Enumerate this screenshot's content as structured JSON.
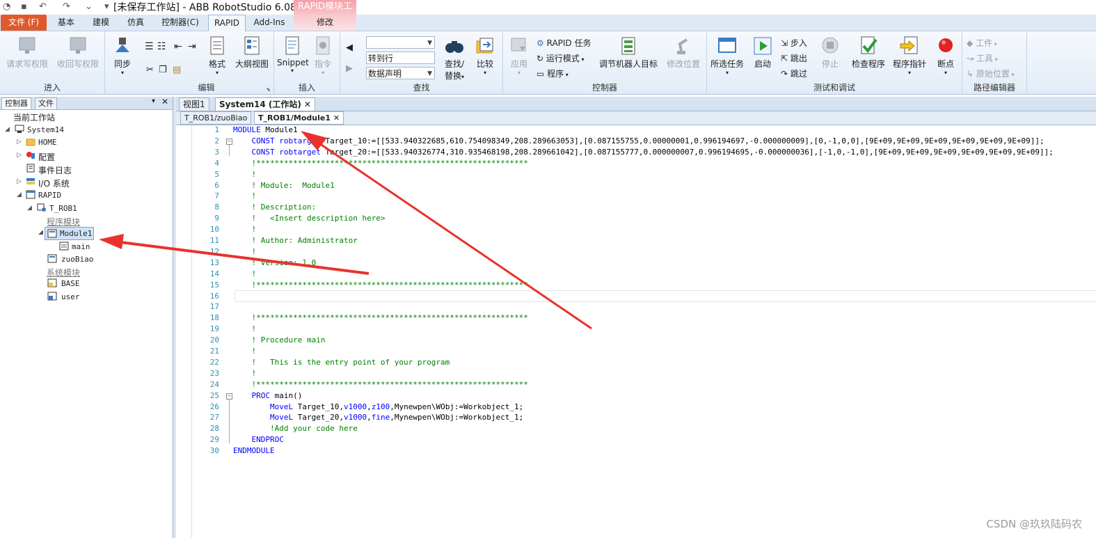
{
  "titlebar": {
    "title": "[未保存工作站] - ABB RobotStudio 6.08",
    "context_tab": "RAPID模块工具"
  },
  "ribbon_tabs": [
    "文件 (F)",
    "基本",
    "建模",
    "仿真",
    "控制器(C)",
    "RAPID",
    "Add-Ins",
    "修改"
  ],
  "ribbon": {
    "groups": {
      "access": "进入",
      "edit": "编辑",
      "insert": "插入",
      "find": "查找",
      "controller": "控制器",
      "test": "测试和调试",
      "path": "路径编辑器"
    },
    "buttons": {
      "request_write": "请求写权限",
      "revoke_write": "收回写权限",
      "sync": "同步",
      "format": "格式",
      "outline": "大纲视图",
      "snippet": "Snippet",
      "instruction": "指令",
      "find_replace_1": "查找/",
      "find_replace_2": "替换",
      "compare": "比较",
      "apply": "应用",
      "rapid_task": "RAPID 任务",
      "run_mode": "运行模式",
      "program": "程序",
      "adjust_targets": "调节机器人目标",
      "modify_position": "修改位置",
      "selected_tasks": "所选任务",
      "start": "启动",
      "step_in": "步入",
      "step_out": "跳出",
      "step_over": "跳过",
      "stop": "停止",
      "check_program": "检查程序",
      "program_pointer": "程序指针",
      "breakpoint": "断点",
      "workobject": "工件",
      "tool": "工具",
      "home_position": "原始位置"
    },
    "find_combo_1": "",
    "find_combo_2": "转到行",
    "find_combo_3": "数据声明"
  },
  "left_panel": {
    "tabs": [
      "控制器",
      "文件"
    ],
    "tree": {
      "current_station": "当前工作站",
      "system": "System14",
      "home": "HOME",
      "config": "配置",
      "event_log": "事件日志",
      "io": "I/O 系统",
      "rapid": "RAPID",
      "task": "T_ROB1",
      "program_modules": "程序模块",
      "module1": "Module1",
      "main": "main",
      "zuobiao": "zuoBiao",
      "system_modules": "系统模块",
      "base": "BASE",
      "user": "user"
    }
  },
  "doc_tabs_top": [
    "视图1",
    "System14 (工作站)"
  ],
  "doc_tabs_second": [
    "T_ROB1/zuoBiao",
    "T_ROB1/Module1"
  ],
  "code_lines": [
    {
      "n": "1",
      "t": "MODULE Module1"
    },
    {
      "n": "2",
      "t": "    CONST robtarget Target_10:=[[533.940322685,610.754098349,208.289663053],[0.087155755,0.00000001,0.996194697,-0.000000009],[0,-1,0,0],[9E+09,9E+09,9E+09,9E+09,9E+09,9E+09]];"
    },
    {
      "n": "3",
      "t": "    CONST robtarget Target_20:=[[533.940326774,310.935468198,208.289661042],[0.087155777,0.000000007,0.996194695,-0.000000036],[-1,0,-1,0],[9E+09,9E+09,9E+09,9E+09,9E+09,9E+09]];"
    },
    {
      "n": "4",
      "t": "    !***********************************************************"
    },
    {
      "n": "5",
      "t": "    !"
    },
    {
      "n": "6",
      "t": "    ! Module:  Module1"
    },
    {
      "n": "7",
      "t": "    !"
    },
    {
      "n": "8",
      "t": "    ! Description:"
    },
    {
      "n": "9",
      "t": "    !   <Insert description here>"
    },
    {
      "n": "10",
      "t": "    !"
    },
    {
      "n": "11",
      "t": "    ! Author: Administrator"
    },
    {
      "n": "12",
      "t": "    !"
    },
    {
      "n": "13",
      "t": "    ! Version: 1.0"
    },
    {
      "n": "14",
      "t": "    !"
    },
    {
      "n": "15",
      "t": "    !***********************************************************"
    },
    {
      "n": "16",
      "t": ""
    },
    {
      "n": "17",
      "t": ""
    },
    {
      "n": "18",
      "t": "    !***********************************************************"
    },
    {
      "n": "19",
      "t": "    !"
    },
    {
      "n": "20",
      "t": "    ! Procedure main"
    },
    {
      "n": "21",
      "t": "    !"
    },
    {
      "n": "22",
      "t": "    !   This is the entry point of your program"
    },
    {
      "n": "23",
      "t": "    !"
    },
    {
      "n": "24",
      "t": "    !***********************************************************"
    },
    {
      "n": "25",
      "t": "    PROC main()"
    },
    {
      "n": "26",
      "t": "        MoveL Target_10,v1000,z100,Mynewpen\\WObj:=Workobject_1;"
    },
    {
      "n": "27",
      "t": "        MoveL Target_20,v1000,fine,Mynewpen\\WObj:=Workobject_1;"
    },
    {
      "n": "28",
      "t": "        !Add your code here"
    },
    {
      "n": "29",
      "t": "    ENDPROC"
    },
    {
      "n": "30",
      "t": "ENDMODULE"
    }
  ],
  "watermark": "CSDN @玖玖陆码农",
  "colors": {
    "file_tab": "#e0592a",
    "keyword": "#0000ff",
    "comment": "#008000",
    "line_number": "#2b91af",
    "annotation_arrow": "#e8322b"
  }
}
